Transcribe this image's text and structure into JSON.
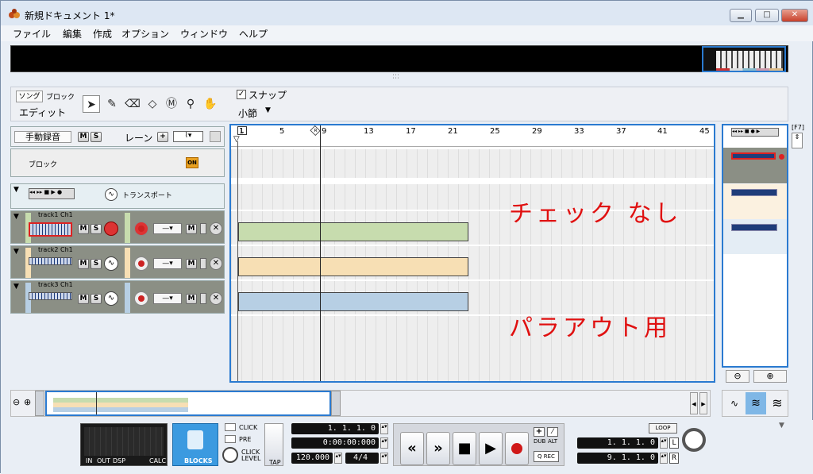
{
  "window": {
    "title": "新規ドキュメント 1*",
    "minimize": "▁",
    "maximize": "□",
    "close": "✕"
  },
  "menu": [
    "ファイル",
    "編集",
    "作成",
    "オプション",
    "ウィンドウ",
    "ヘルプ"
  ],
  "toolbar": {
    "song": "ソング",
    "block": "ブロック",
    "edit": "エディット",
    "snap": "スナップ",
    "snap_checked": true,
    "snap_value": "小節"
  },
  "tracks_panel": {
    "manual_rec": "手動録音",
    "m": "M",
    "s": "S",
    "lane": "レーン",
    "plus": "+",
    "block_row": "ブロック",
    "on": "ON",
    "transport_row": "トランスポート",
    "tracks": [
      {
        "name": "track1 Ch1",
        "color": "#c7dcae"
      },
      {
        "name": "track2 Ch1",
        "color": "#f7dfb4"
      },
      {
        "name": "track3 Ch1",
        "color": "#b7cfe4"
      }
    ]
  },
  "ruler": {
    "L": "L",
    "R": "R",
    "bars": [
      "1",
      "5",
      "9",
      "13",
      "17",
      "21",
      "25",
      "29",
      "33",
      "37",
      "41",
      "45"
    ]
  },
  "annotations": {
    "line1": "チェック なし",
    "line2": "パラアウト用"
  },
  "right_panel": {
    "f7": "[F7]"
  },
  "transport": {
    "click": "CLICK",
    "pre": "PRE",
    "click_level": "CLICK LEVEL",
    "tap": "TAP",
    "blocks": "BLOCKS",
    "meter_labels": [
      "IN",
      "OUT",
      "DSP",
      "CALC"
    ],
    "position": "1. 1. 1.   0",
    "time": "0:00:00:000",
    "tempo": "120.000",
    "signature": "4/4",
    "rewind": "«",
    "ffwd": "»",
    "stop": "■",
    "play": "▶",
    "dub": "DUB",
    "alt": "ALT",
    "qrec": "Q REC",
    "loop": "LOOP",
    "locator_l": "1. 1. 1.   0",
    "locator_r": "9. 1. 1.   0",
    "L": "L",
    "R": "R"
  }
}
